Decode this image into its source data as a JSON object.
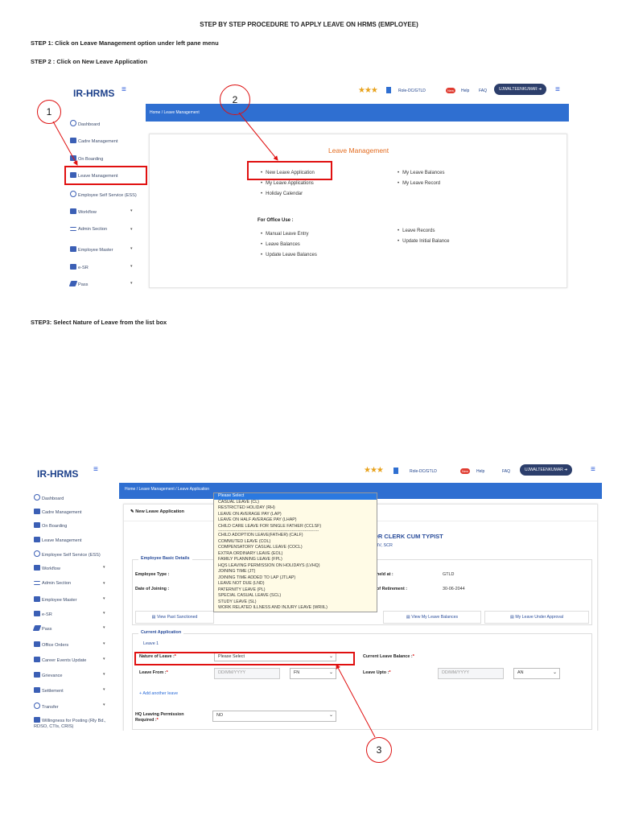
{
  "document": {
    "title": "STEP BY STEP PROCEDURE TO APPLY LEAVE ON   HRMS (EMPLOYEE)",
    "step1": "STEP 1: Click on Leave Management option under left pane menu",
    "step2": "STEP 2 :  Click on New Leave Application",
    "step3": "STEP3:  Select Nature of Leave  from the list box"
  },
  "header": {
    "brand": "IR-HRMS",
    "menu_icon": "hamburger-icon",
    "stars": "★★★",
    "role": "Role-DC/GTLD",
    "help": "Help",
    "faq": "FAQ",
    "new_badge": "New",
    "user1": "UJWALTEENKUMAR",
    "user2": "UJWALTEENKUMAR",
    "logout_icon": "arrow-down-icon"
  },
  "shot1": {
    "breadcrumb": "Home  /  Leave Management",
    "sidebar": [
      "Dashboard",
      "Cadre Management",
      "On Boarding",
      "Leave Management",
      "Employee Self Service (ESS)",
      "Workflow",
      "Admin Section",
      "Employee Master",
      "e-SR",
      "Pass"
    ],
    "panel_title": "Leave Management",
    "col1": [
      "New Leave Application",
      "My Leave Applications",
      "Holiday Calendar"
    ],
    "col2": [
      "My Leave Balances",
      "My Leave Record"
    ],
    "office_use": "For Office Use :",
    "col3": [
      "Manual Leave Entry",
      "Leave Balances",
      "Update Leave Balances"
    ],
    "col4": [
      "Leave Records",
      "Update Initial Balance"
    ],
    "callout1": "1",
    "callout2": "2"
  },
  "shot2": {
    "breadcrumb": "Home  /  Leave Management  /  Leave Application",
    "sidebar": [
      "Dashboard",
      "Cadre Management",
      "On Boarding",
      "Leave Management",
      "Employee Self Service (ESS)",
      "Workflow",
      "Admin Section",
      "Employee Master",
      "e-SR",
      "Pass",
      "Office Orders",
      "Career Events Update",
      "Grievance",
      "Settlement",
      "Transfer",
      "Willingness for Posting (Rly Bd., RDSO, CTIs, CRIS)"
    ],
    "form_title": "New Leave Application",
    "designation": "IOR CLERK CUM TYPIST",
    "division": "/ DIV, SCR",
    "basic_details": "Employee Basic Details",
    "employee_type_label": "Employee Type :",
    "date_of_joining_label": "Date of Joining :",
    "held_at_label": "held at :",
    "held_at_value": "GTLD",
    "retirement_label": "of Retirement :",
    "retirement_value": "30-06-2044",
    "btn_past": "View Past Sanctioned",
    "btn_balances": "View My Leave Balances",
    "btn_approval": "My Leave Under Approval",
    "current_application": "Current Application",
    "leave1": "Leave 1",
    "nature_label": "Nature of Leave :",
    "nature_value": "Please Select",
    "balance_label": "Current Leave Balance :",
    "leave_from_label": "Leave From :",
    "leave_from_placeholder": "DD/MM/YYYY",
    "from_half": "FN",
    "leave_upto_label": "Leave Upto :",
    "leave_upto_placeholder": "DD/MM/YYYY",
    "upto_half": "AN",
    "add_leave": "+ Add another leave",
    "hq_label": "HQ Leaving Permission Required :",
    "hq_value": "NO",
    "dropdown": [
      "Please Select",
      "CASUAL LEAVE (CL)",
      "RESTRICTED HOLIDAY (RH)",
      "LEAVE ON AVERAGE PAY (LAP)",
      "LEAVE ON HALF AVERAGE PAY (LHAP)",
      "CHILD CARE LEAVE FOR SINGLE FATHER (CCLSF)",
      "-----------------------------------------------------------------------",
      "CHILD ADOPTION LEAVE(FATHER) (CALF)",
      "COMMUTED LEAVE (COL)",
      "COMPENSATORY CASUAL LEAVE (COCL)",
      "EXTRA ORDINARY LEAVE (EOL)",
      "FAMILY PLANNING LEAVE (FPL)",
      "HQS LEAVING PERMISSION ON HOLIDAYS (LVHQ)",
      "JOINING TIME (JT)",
      "JOINING TIME ADDED TO LAP (JTLAP)",
      "LEAVE NOT DUE (LND)",
      "PATERNITY LEAVE (PL)",
      "SPECIAL CASUAL LEAVE (SCL)",
      "STUDY LEAVE (SL)",
      "WORK RELATED ILLNESS AND INJURY LEAVE (WRIIL)"
    ],
    "callout3": "3"
  },
  "colors": {
    "brand": "#1b3f8a",
    "bar": "#2f6fd1",
    "accent": "#e36b1f",
    "highlight": "#e01010"
  }
}
